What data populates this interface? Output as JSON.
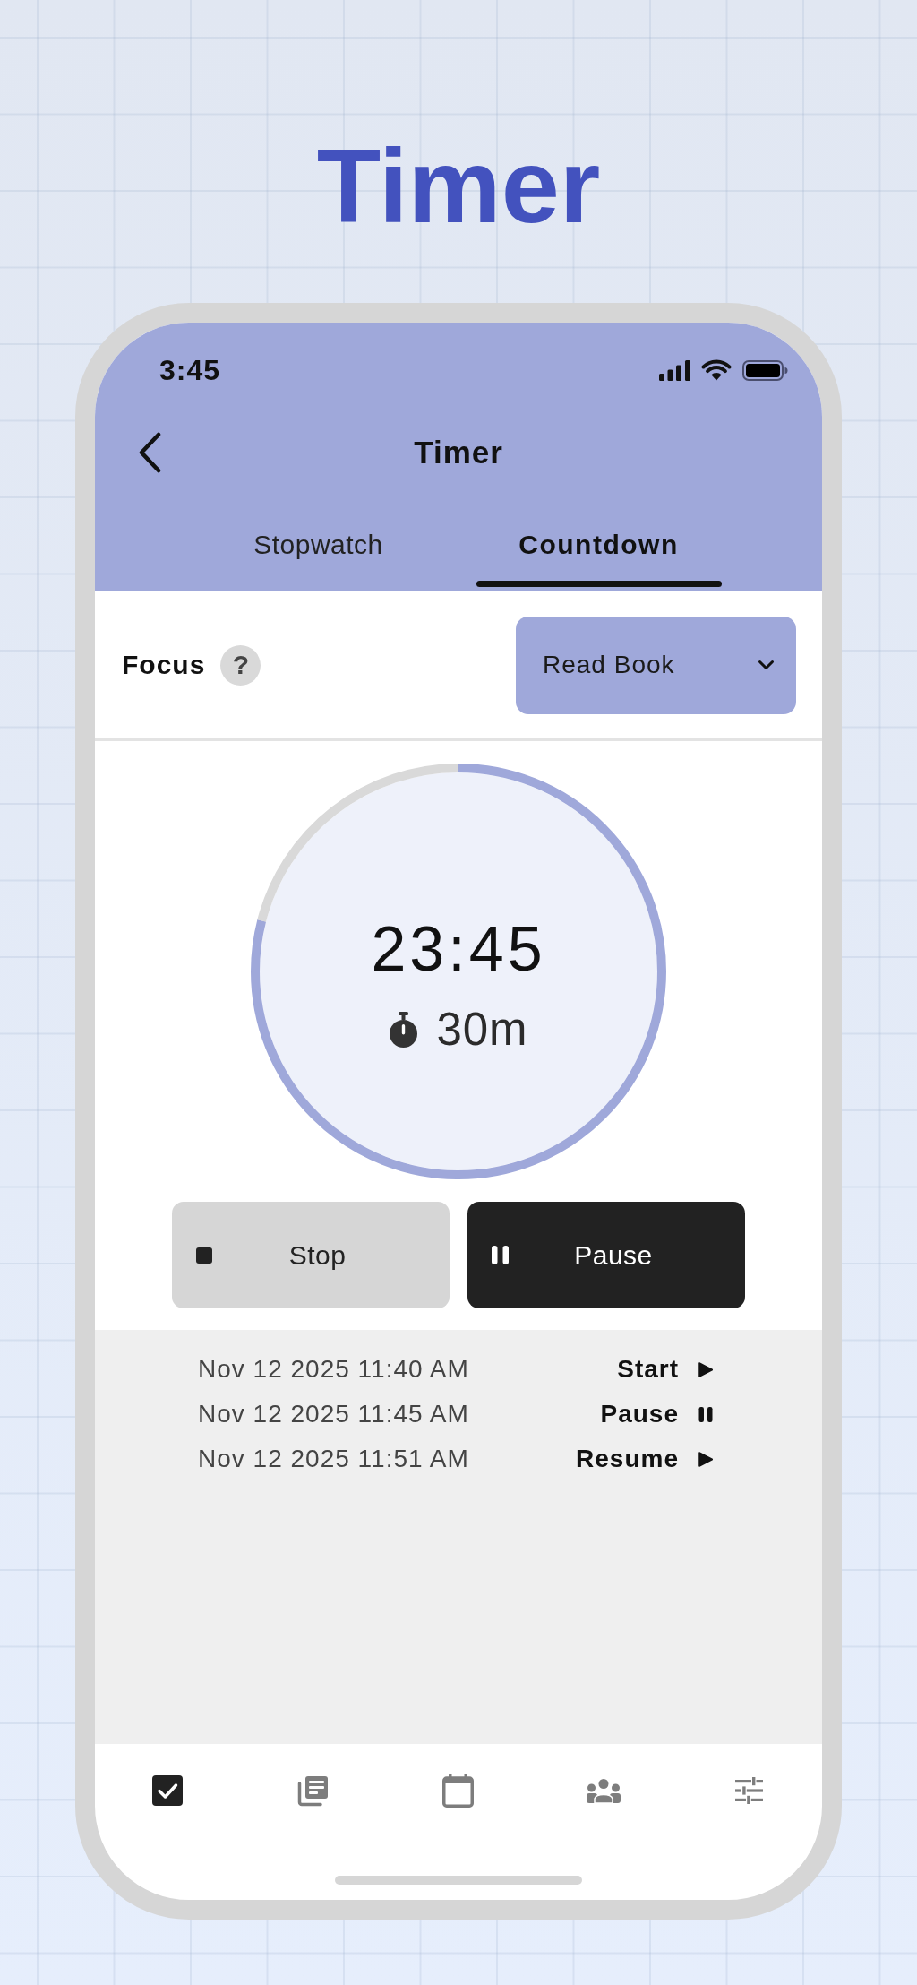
{
  "page_title": "Timer",
  "status_bar": {
    "time": "3:45"
  },
  "header": {
    "title": "Timer"
  },
  "tabs": [
    {
      "label": "Stopwatch",
      "selected": false
    },
    {
      "label": "Countdown",
      "selected": true
    }
  ],
  "focus": {
    "label": "Focus",
    "help": "?",
    "dropdown": {
      "value": "Read Book"
    }
  },
  "timer": {
    "remaining": "23:45",
    "duration": "30m",
    "level": 0.79
  },
  "buttons": [
    {
      "kind": "stop",
      "label": "Stop"
    },
    {
      "kind": "pause",
      "label": "Pause"
    }
  ],
  "log": [
    {
      "time": "Nov 12 2025 11:40 AM",
      "action": "Start",
      "kind": "play"
    },
    {
      "time": "Nov 12 2025 11:45 AM",
      "action": "Pause",
      "kind": "pause"
    },
    {
      "time": "Nov 12 2025 11:51 AM",
      "action": "Resume",
      "kind": "play"
    }
  ],
  "nav": [
    {
      "kind": "checkbox",
      "selected": true
    },
    {
      "kind": "notes",
      "selected": false
    },
    {
      "kind": "calendar",
      "selected": false
    },
    {
      "kind": "group",
      "selected": false
    },
    {
      "kind": "sliders",
      "selected": false
    }
  ]
}
